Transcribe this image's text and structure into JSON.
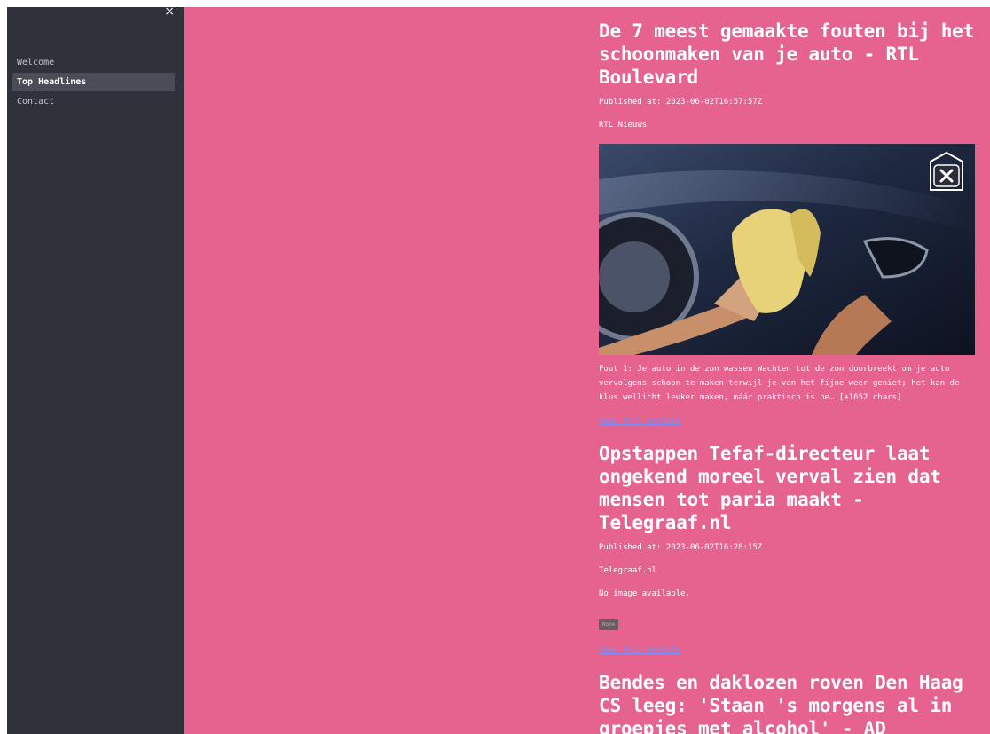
{
  "sidebar": {
    "close_glyph": "×",
    "items": [
      {
        "label": "Welcome"
      },
      {
        "label": "Top Headlines"
      },
      {
        "label": "Contact"
      }
    ]
  },
  "articles": [
    {
      "title": "De 7 meest gemaakte fouten bij het schoonmaken van je auto - RTL Boulevard",
      "published": "Published at: 2023-06-02T16:57:57Z",
      "source": "RTL Nieuws",
      "description": "Fout 1: Je auto in de zon wassen Wachten tot de zon doorbreekt om je auto vervolgens schoon te maken terwijl je van het fijne weer geniet; het kan de klus wellicht leuker maken, máár praktisch is he… [+1652 chars]",
      "link": "Read full article"
    },
    {
      "title": "Opstappen Tefaf-directeur laat ongekend moreel verval zien dat mensen tot paria maakt - Telegraaf.nl",
      "published": "Published at: 2023-06-02T16:28:15Z",
      "source": "Telegraaf.nl",
      "no_image": "No image available.",
      "badge": "None",
      "link": "Read full article"
    },
    {
      "title": "Bendes en daklozen roven Den Haag CS leeg: 'Staan 's morgens al in groepjes met alcohol' - AD"
    }
  ],
  "icons": {
    "image_close": "close-x-icon",
    "sidebar_close": "close-icon"
  },
  "colors": {
    "sidebar": "#2f313b",
    "main": "#e7638f",
    "link": "#7f8df0"
  }
}
